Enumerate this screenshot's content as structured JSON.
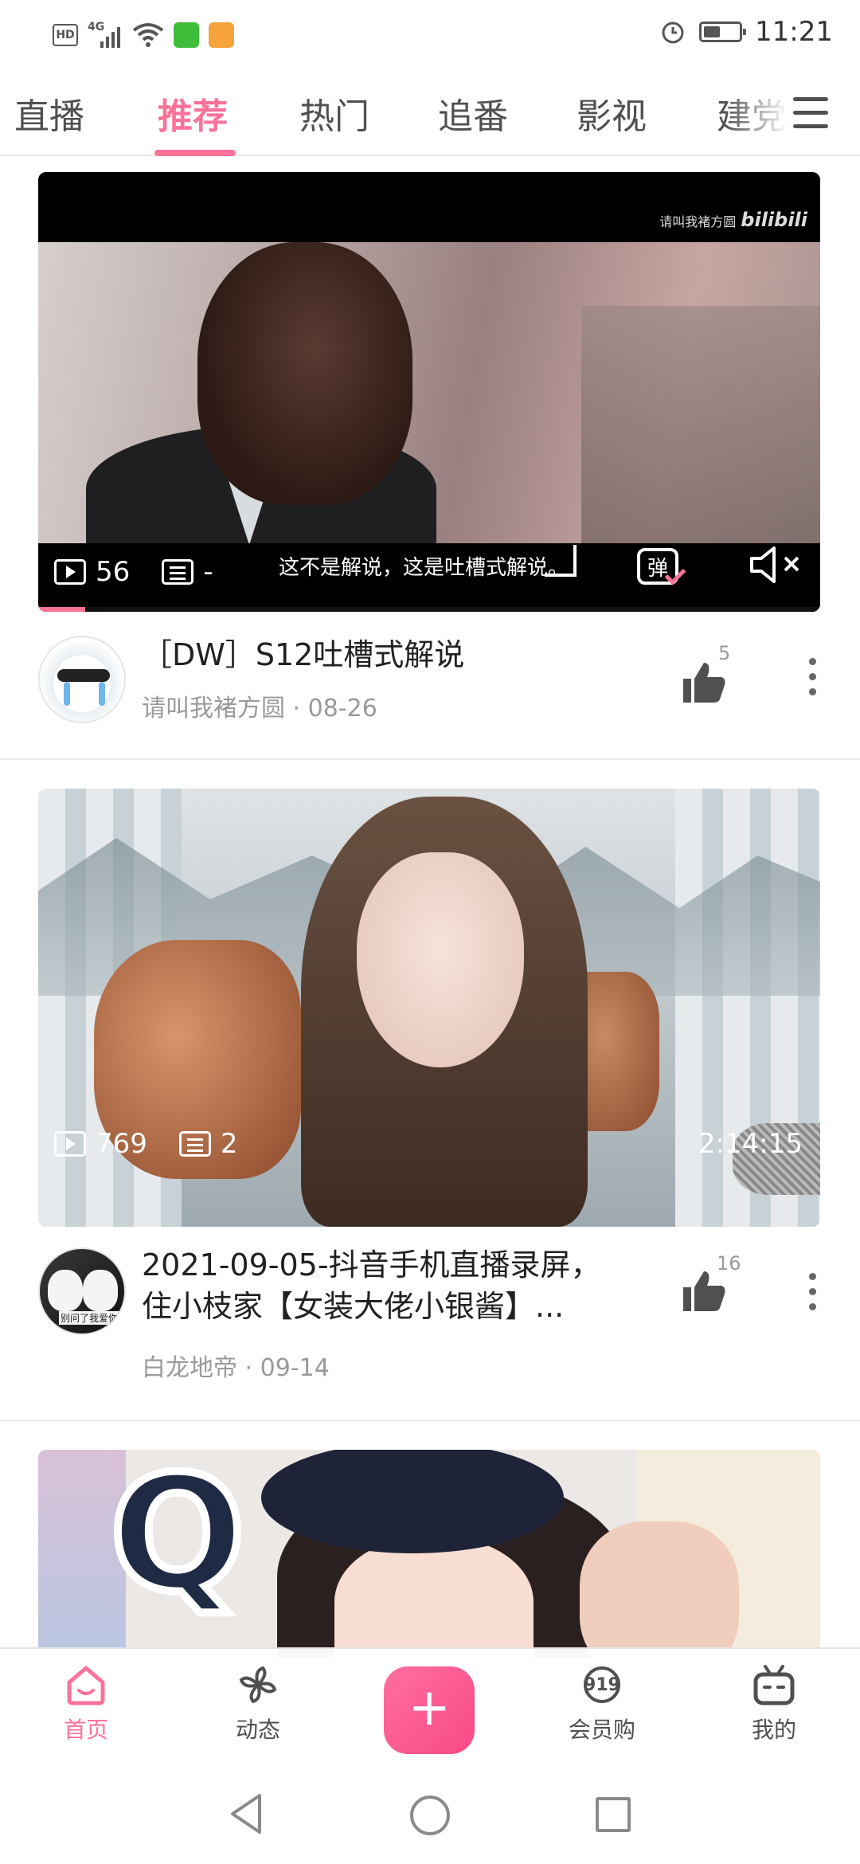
{
  "status_bar": {
    "hd": "HD",
    "network": "4G",
    "time": "11:21"
  },
  "tabs": [
    {
      "label": "直播",
      "active": false
    },
    {
      "label": "推荐",
      "active": true
    },
    {
      "label": "热门",
      "active": false
    },
    {
      "label": "追番",
      "active": false
    },
    {
      "label": "影视",
      "active": false
    },
    {
      "label": "建党",
      "active": false
    }
  ],
  "cards": [
    {
      "watermark": "请叫我褚方圆",
      "watermark_brand": "bilibili",
      "subtitle": "这不是解说，这是吐槽式解说。",
      "views": "56",
      "danmaku": "-",
      "danmaku_toggle": "弹",
      "title": "［DW］S12吐槽式解说",
      "byline": "请叫我褚方圆 · 08-26",
      "likes": "5",
      "progress": 0.06
    },
    {
      "views": "769",
      "danmaku": "2",
      "duration": "2:14:15",
      "title": "2021-09-05-抖音手机直播录屏，住小枝家【女装大佬小银酱】...",
      "byline": "白龙地帝 · 09-14",
      "likes": "16",
      "avatar_caption": "别问了我爱你"
    },
    {
      "overlay_letter": "Q"
    }
  ],
  "bottom_nav": {
    "home": "首页",
    "dynamics": "动态",
    "publish": "+",
    "vip_shop": "会员购",
    "vip_badge": "919",
    "mine": "我的"
  },
  "colors": {
    "accent": "#fb7299",
    "text": "#212121",
    "muted": "#9a9a9a"
  }
}
